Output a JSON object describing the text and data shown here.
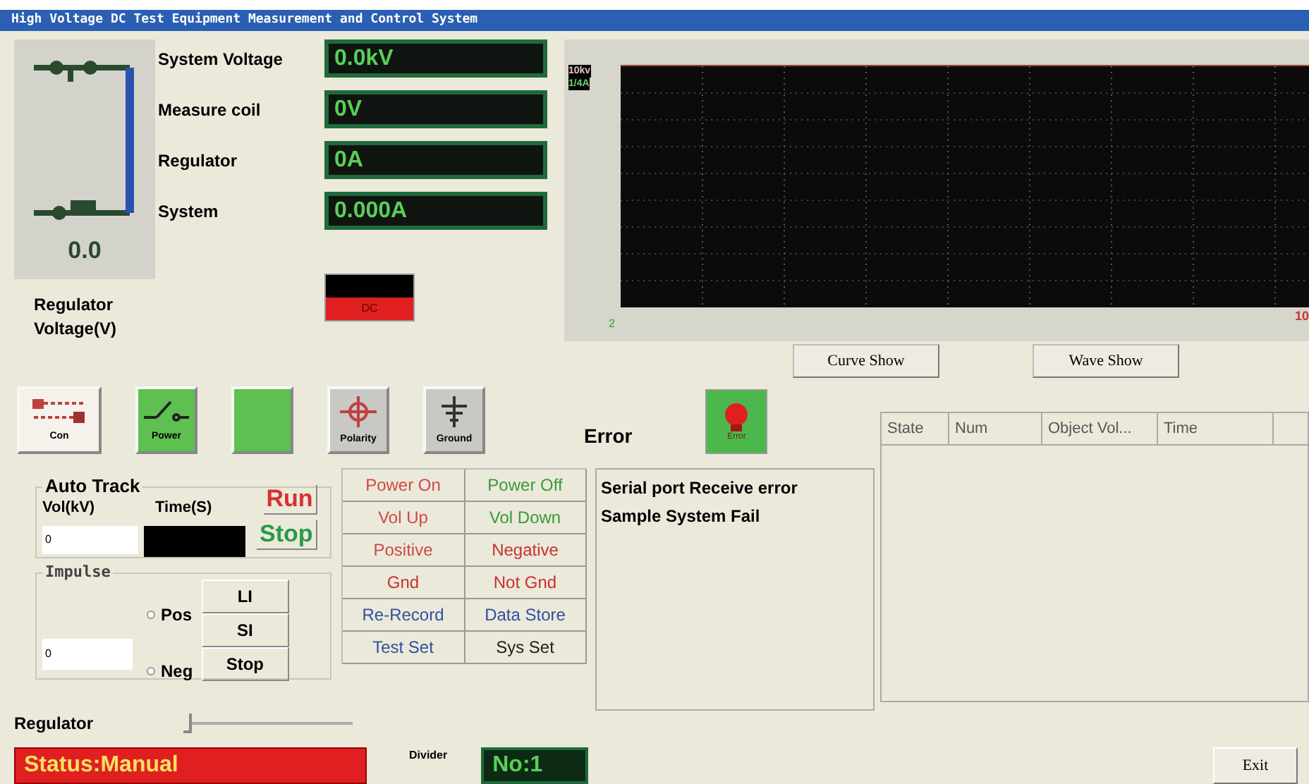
{
  "window": {
    "title": "High Voltage DC Test Equipment Measurement and Control System"
  },
  "gauge": {
    "value": "0.0",
    "label": "Regulator Voltage(V)"
  },
  "readouts": [
    {
      "label": "System Voltage",
      "value": "0.0kV"
    },
    {
      "label": "Measure coil",
      "value": "0V"
    },
    {
      "label": "Regulator",
      "value": "0A"
    },
    {
      "label": "System",
      "value": "0.000A"
    }
  ],
  "dc_indicator": {
    "label": "DC"
  },
  "scope": {
    "y_labels": [
      "10kv",
      "1/4A"
    ],
    "origin_label": "2",
    "x_end_label": "10"
  },
  "view_buttons": [
    "Curve Show",
    "Wave Show"
  ],
  "icon_buttons": [
    {
      "kind": "con",
      "label": "Con"
    },
    {
      "kind": "power",
      "label": "Power"
    },
    {
      "kind": "blank"
    },
    {
      "kind": "polarity",
      "label": "Polarity"
    },
    {
      "kind": "ground",
      "label": "Ground"
    }
  ],
  "error": {
    "title": "Error",
    "lamp_label": "Error",
    "messages": [
      "Serial port Receive error",
      "Sample System Fail"
    ]
  },
  "auto_track": {
    "title": "Auto Track",
    "vol_label": "Vol(kV)",
    "time_label": "Time(S)",
    "vol_value": "0",
    "run": "Run",
    "stop": "Stop"
  },
  "impulse": {
    "title": "Impulse",
    "value": "0",
    "options": [
      {
        "label": "Pos",
        "selected": false
      },
      {
        "label": "Neg",
        "selected": false
      }
    ],
    "buttons": [
      "LI",
      "SI",
      "Stop"
    ]
  },
  "controls": [
    {
      "label": "Power On",
      "color": "#d04848"
    },
    {
      "label": "Power Off",
      "color": "#3a9a3a"
    },
    {
      "label": "Vol Up",
      "color": "#d04848"
    },
    {
      "label": "Vol Down",
      "color": "#3a9a3a"
    },
    {
      "label": "Positive",
      "color": "#d04848"
    },
    {
      "label": "Negative",
      "color": "#c83030"
    },
    {
      "label": "Gnd",
      "color": "#c83030"
    },
    {
      "label": "Not Gnd",
      "color": "#c83030"
    },
    {
      "label": "Re-Record",
      "color": "#3050a0"
    },
    {
      "label": "Data Store",
      "color": "#3050a0"
    },
    {
      "label": "Test Set",
      "color": "#3050a0"
    },
    {
      "label": "Sys Set",
      "color": "#202020"
    }
  ],
  "table": {
    "columns": [
      "State",
      "Num",
      "Object Vol...",
      "Time"
    ]
  },
  "regulator": {
    "label": "Regulator",
    "level": 0
  },
  "status": "Status:Manual",
  "divider": {
    "label": "Divider",
    "value": "No:1"
  },
  "exit": "Exit"
}
